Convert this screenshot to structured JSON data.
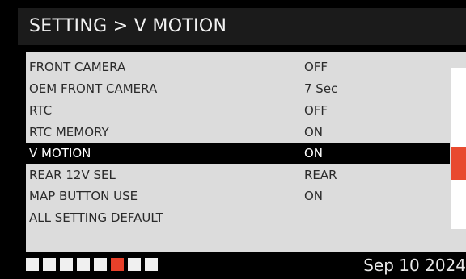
{
  "header": {
    "title": "SETTING > V MOTION"
  },
  "menu": {
    "items": [
      {
        "label": "FRONT CAMERA",
        "value": "OFF"
      },
      {
        "label": "OEM FRONT CAMERA",
        "value": "7 Sec"
      },
      {
        "label": "RTC",
        "value": "OFF"
      },
      {
        "label": "RTC MEMORY",
        "value": "ON"
      },
      {
        "label": "V MOTION",
        "value": "ON",
        "selected": true
      },
      {
        "label": "REAR 12V SEL",
        "value": "REAR"
      },
      {
        "label": "MAP BUTTON USE",
        "value": "ON"
      },
      {
        "label": "ALL SETTING DEFAULT",
        "value": ""
      }
    ]
  },
  "pager": {
    "total_pages": 8,
    "current_page": 6
  },
  "status": {
    "date": "Sep 10 2024"
  },
  "colors": {
    "accent": "#e8402a",
    "selected_row_bg": "#000000",
    "panel_bg": "#dcdcdc",
    "header_bg": "#1b1b1b"
  }
}
